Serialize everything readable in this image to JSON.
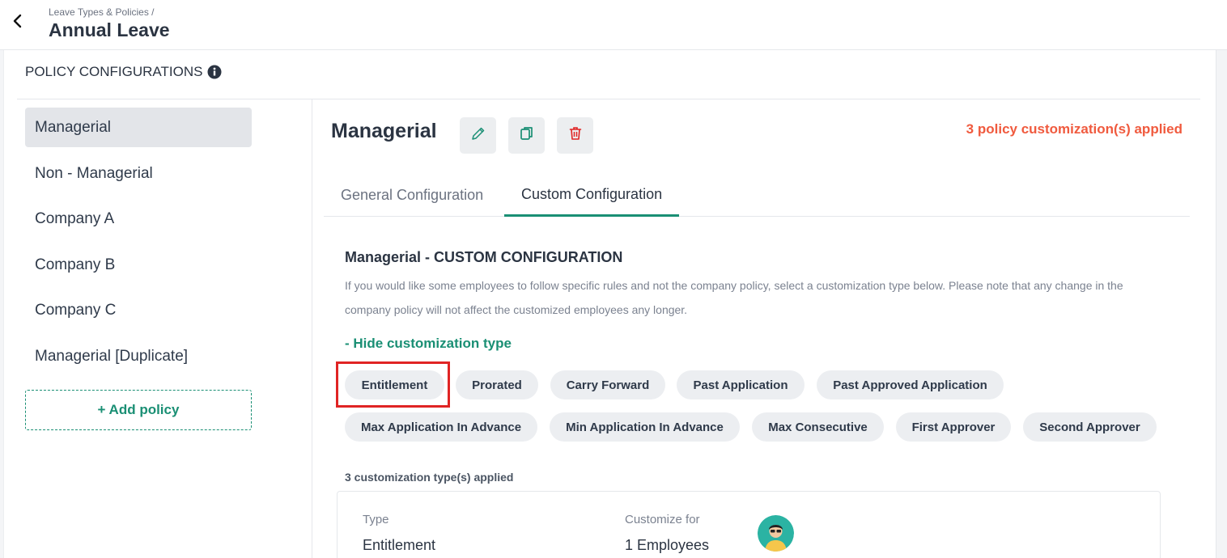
{
  "header": {
    "breadcrumb": "Leave Types & Policies /",
    "title": "Annual Leave"
  },
  "section": {
    "title": "POLICY CONFIGURATIONS"
  },
  "sidebar": {
    "items": [
      {
        "label": "Managerial"
      },
      {
        "label": "Non - Managerial"
      },
      {
        "label": "Company A"
      },
      {
        "label": "Company B"
      },
      {
        "label": "Company C"
      },
      {
        "label": "Managerial [Duplicate]"
      }
    ],
    "add_label": "+ Add policy"
  },
  "content": {
    "policy_name": "Managerial",
    "applied_count": "3 policy customization(s) applied",
    "tabs": [
      {
        "label": "General Configuration"
      },
      {
        "label": "Custom Configuration"
      }
    ],
    "cc_title": "Managerial - CUSTOM CONFIGURATION",
    "cc_desc": "If you would like some employees to follow specific rules and not the company policy, select a customization type below. Please note that any change in the company policy will not affect the customized employees any longer.",
    "hide_link": "- Hide customization type",
    "chips": [
      "Entitlement",
      "Prorated",
      "Carry Forward",
      "Past Application",
      "Past Approved Application",
      "Max Application In Advance",
      "Min Application In Advance",
      "Max Consecutive",
      "First Approver",
      "Second Approver"
    ],
    "applied_label": "3 customization type(s) applied",
    "card": {
      "type_label": "Type",
      "type_value": "Entitlement",
      "customize_label": "Customize for",
      "customize_value": "1 Employees"
    }
  },
  "colors": {
    "accent": "#1a8f74",
    "warning": "#f05a3e",
    "delete": "#e02424",
    "highlight": "#e02424"
  }
}
